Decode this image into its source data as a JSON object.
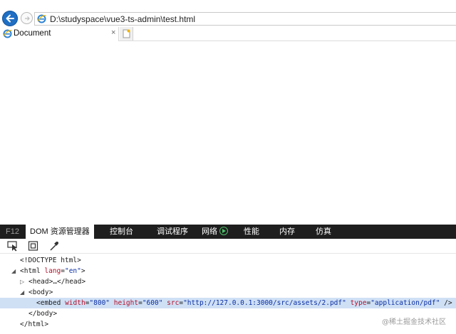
{
  "address_bar": {
    "url": "D:\\studyspace\\vue3-ts-admin\\test.html"
  },
  "tabs": [
    {
      "label": "Document",
      "close": "×"
    }
  ],
  "devtools": {
    "tabs": [
      {
        "label": "F12"
      },
      {
        "label": "DOM 资源管理器"
      },
      {
        "label": "控制台"
      },
      {
        "label": "调试程序"
      },
      {
        "label": "网络"
      },
      {
        "label": "性能"
      },
      {
        "label": "内存"
      },
      {
        "label": "仿真"
      }
    ],
    "active_tab": "DOM 资源管理器",
    "dom_lines": {
      "doctype": "<!DOCTYPE html>",
      "html_open": "<html",
      "html_lang_attr": "lang",
      "html_lang_val": "\"en\"",
      "html_open_end": ">",
      "head": "<head>…</head>",
      "body_open": "<body>",
      "embed_open": "<embed",
      "width_attr": "width",
      "width_val": "\"800\"",
      "height_attr": "height",
      "height_val": "\"600\"",
      "src_attr": "src",
      "src_val": "\"http://127.0.0.1:3000/src/assets/2.pdf\"",
      "type_attr": "type",
      "type_val": "\"application/pdf\"",
      "embed_close": "/>",
      "body_close": "</body>",
      "html_close": "</html>"
    }
  },
  "watermark": "@稀土掘金技术社区",
  "colors": {
    "devtools_bar": "#1e1e1e",
    "selected_row": "#cfe0f5",
    "attr_name": "#b3102a",
    "attr_value": "#0a2fa5",
    "back_button": "#1f6fc4"
  }
}
